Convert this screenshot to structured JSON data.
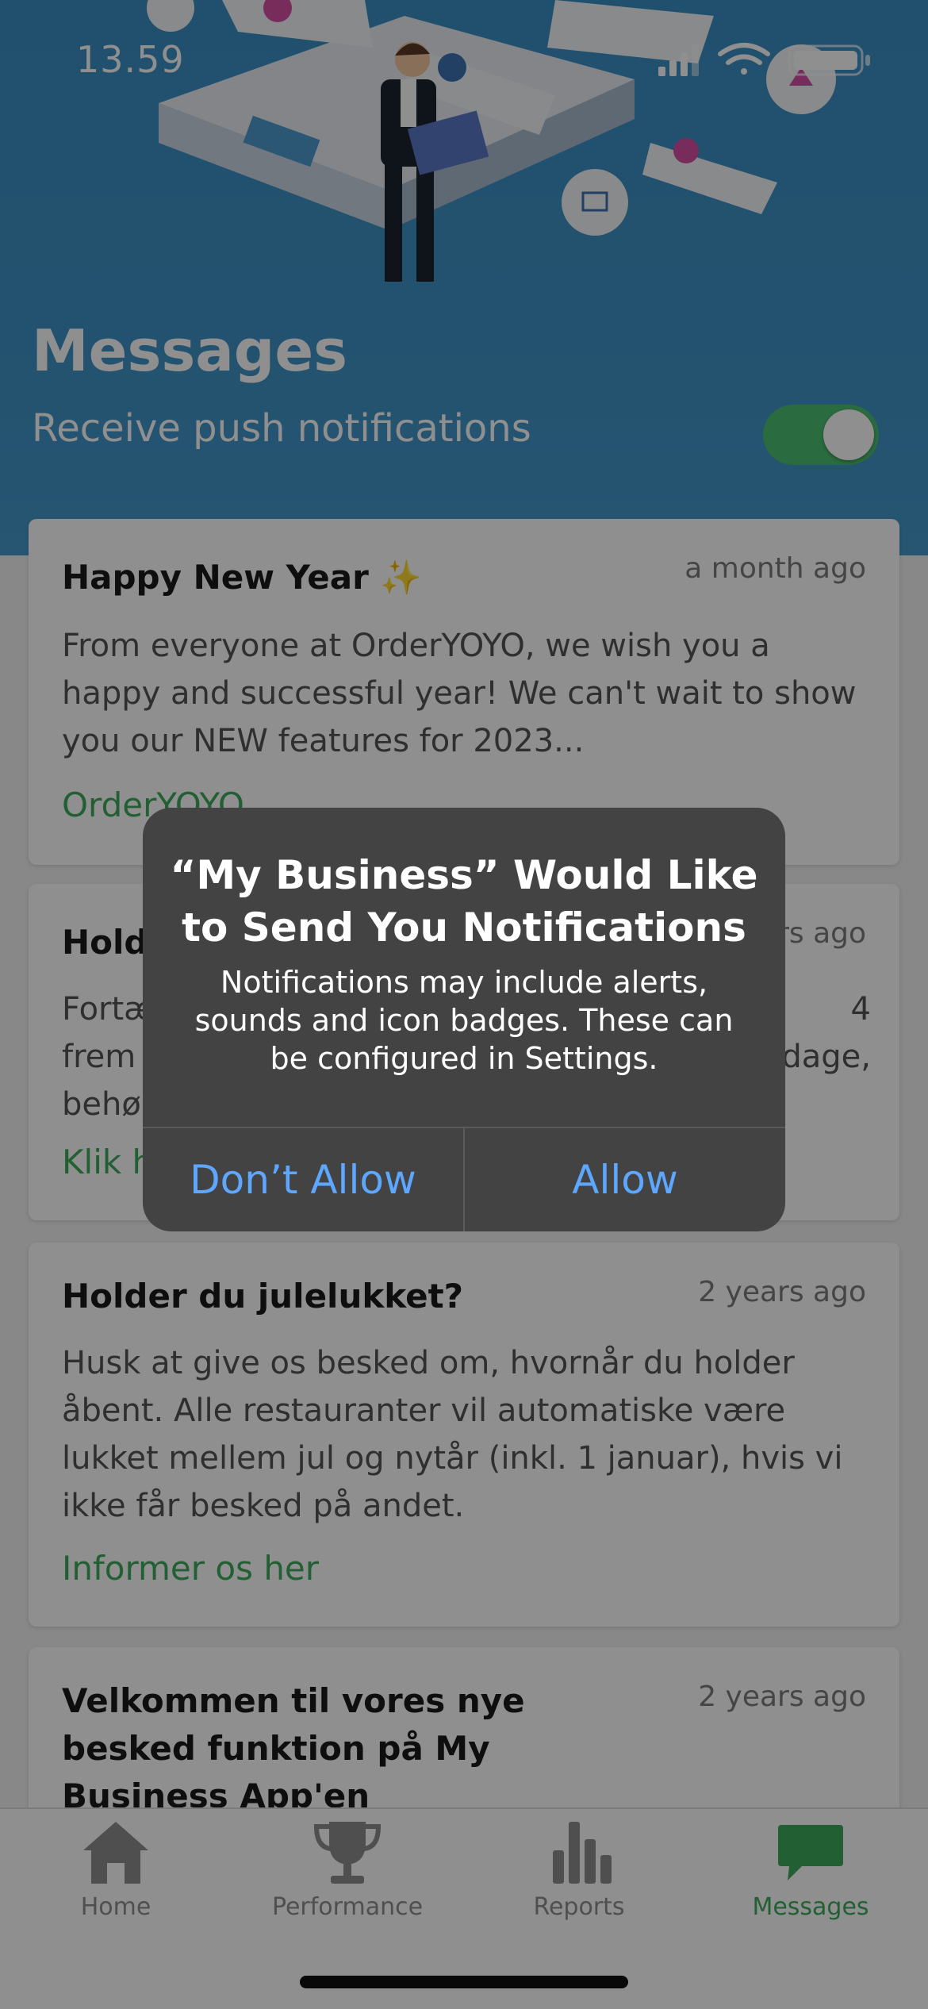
{
  "status_bar": {
    "time": "13.59",
    "icons": [
      "cellular-signal-icon",
      "wifi-icon",
      "battery-icon"
    ]
  },
  "header": {
    "title": "Messages",
    "push_label": "Receive push notifications",
    "push_enabled": true
  },
  "messages": [
    {
      "title": "Happy New Year",
      "emoji": "✨",
      "time": "a month ago",
      "body": "From everyone at OrderYOYO, we wish you a happy and successful year! We can't wait to show you our NEW features for 2023...",
      "link": "OrderYOYO"
    },
    {
      "title": "Holde",
      "time": "rs ago",
      "body_lines": [
        "Fortæ",
        "frem",
        "behø"
      ],
      "body_right": [
        "4",
        "dage,"
      ],
      "link": "Klik h"
    },
    {
      "title": "Holder du julelukket?",
      "time": "2 years ago",
      "body": "Husk at give os besked om, hvornår du holder åbent. Alle restauranter vil automatiske være lukket mellem jul og nytår (inkl. 1 januar), hvis vi ikke får besked på andet.",
      "link": "Informer os her"
    },
    {
      "title": "Velkommen til vores nye besked funktion på My Business App'en",
      "time": "2 years ago"
    }
  ],
  "tabbar": {
    "tabs": [
      {
        "label": "Home",
        "icon": "home-icon",
        "active": false
      },
      {
        "label": "Performance",
        "icon": "trophy-icon",
        "active": false
      },
      {
        "label": "Reports",
        "icon": "bar-chart-icon",
        "active": false
      },
      {
        "label": "Messages",
        "icon": "chat-bubble-icon",
        "active": true
      }
    ]
  },
  "alert": {
    "title": "“My Business” Would Like to Send You Notifications",
    "message": "Notifications may include alerts, sounds and icon badges. These can be configured in Settings.",
    "deny_label": "Don’t Allow",
    "allow_label": "Allow"
  },
  "colors": {
    "header_blue": "#3e93c6",
    "accent_green": "#3eab5d",
    "alert_bg": "#434343",
    "alert_button": "#5ea7ff"
  }
}
